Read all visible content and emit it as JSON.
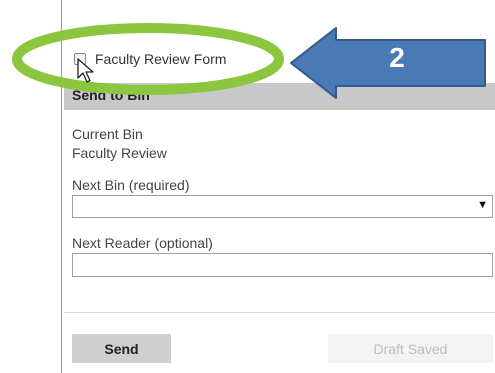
{
  "form_checkbox": {
    "label": "Faculty Review Form",
    "checked": false
  },
  "callout": {
    "number": "2",
    "arrow_color": "#4a7ab5",
    "highlight_color": "#8cc63f"
  },
  "section": {
    "header": "Send to Bin"
  },
  "current_bin": {
    "label": "Current Bin",
    "value": "Faculty Review"
  },
  "next_bin": {
    "label": "Next Bin (required)",
    "selected": ""
  },
  "next_reader": {
    "label": "Next Reader (optional)",
    "value": ""
  },
  "actions": {
    "send_label": "Send",
    "draft_label": "Draft Saved"
  },
  "icons": {
    "cursor": "mouse-pointer-icon",
    "dropdown": "caret-down-icon"
  }
}
